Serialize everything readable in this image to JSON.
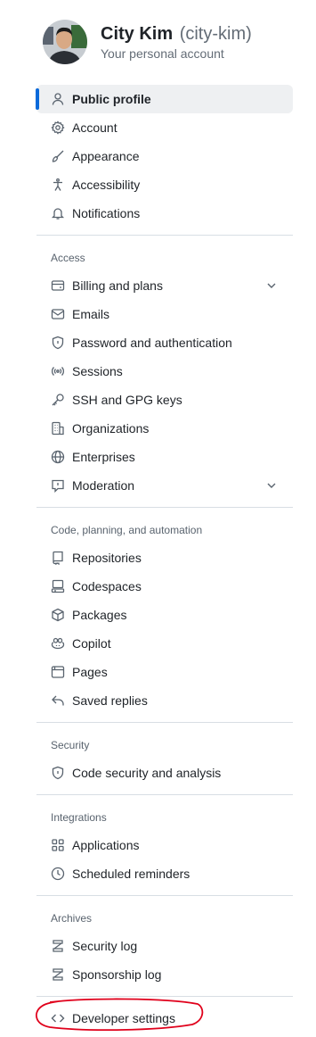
{
  "user": {
    "name": "City Kim",
    "login": "(city-kim)",
    "subtitle": "Your personal account"
  },
  "nav": {
    "top": [
      {
        "label": "Public profile",
        "icon": "person-icon",
        "active": true
      },
      {
        "label": "Account",
        "icon": "gear-icon"
      },
      {
        "label": "Appearance",
        "icon": "paintbrush-icon"
      },
      {
        "label": "Accessibility",
        "icon": "accessibility-icon"
      },
      {
        "label": "Notifications",
        "icon": "bell-icon"
      }
    ],
    "access": {
      "title": "Access",
      "items": [
        {
          "label": "Billing and plans",
          "icon": "credit-card-icon"
        },
        {
          "label": "Emails",
          "icon": "mail-icon"
        },
        {
          "label": "Password and authentication",
          "icon": "shield-lock-icon"
        },
        {
          "label": "Sessions",
          "icon": "broadcast-icon"
        },
        {
          "label": "SSH and GPG keys",
          "icon": "key-icon"
        },
        {
          "label": "Organizations",
          "icon": "organization-icon"
        },
        {
          "label": "Enterprises",
          "icon": "globe-icon"
        },
        {
          "label": "Moderation",
          "icon": "report-icon"
        }
      ]
    },
    "code": {
      "title": "Code, planning, and automation",
      "items": [
        {
          "label": "Repositories",
          "icon": "repo-icon"
        },
        {
          "label": "Codespaces",
          "icon": "codespaces-icon"
        },
        {
          "label": "Packages",
          "icon": "package-icon"
        },
        {
          "label": "Copilot",
          "icon": "copilot-icon"
        },
        {
          "label": "Pages",
          "icon": "browser-icon"
        },
        {
          "label": "Saved replies",
          "icon": "reply-icon"
        }
      ]
    },
    "security": {
      "title": "Security",
      "items": [
        {
          "label": "Code security and analysis",
          "icon": "shield-lock-icon"
        }
      ]
    },
    "integrations": {
      "title": "Integrations",
      "items": [
        {
          "label": "Applications",
          "icon": "apps-icon"
        },
        {
          "label": "Scheduled reminders",
          "icon": "clock-icon"
        }
      ]
    },
    "archives": {
      "title": "Archives",
      "items": [
        {
          "label": "Security log",
          "icon": "log-icon"
        },
        {
          "label": "Sponsorship log",
          "icon": "log-icon"
        }
      ]
    },
    "developer": {
      "label": "Developer settings",
      "icon": "code-icon"
    }
  },
  "colors": {
    "accent": "#0969da",
    "active_bg": "#eef0f2",
    "annotation": "#e0001b"
  }
}
